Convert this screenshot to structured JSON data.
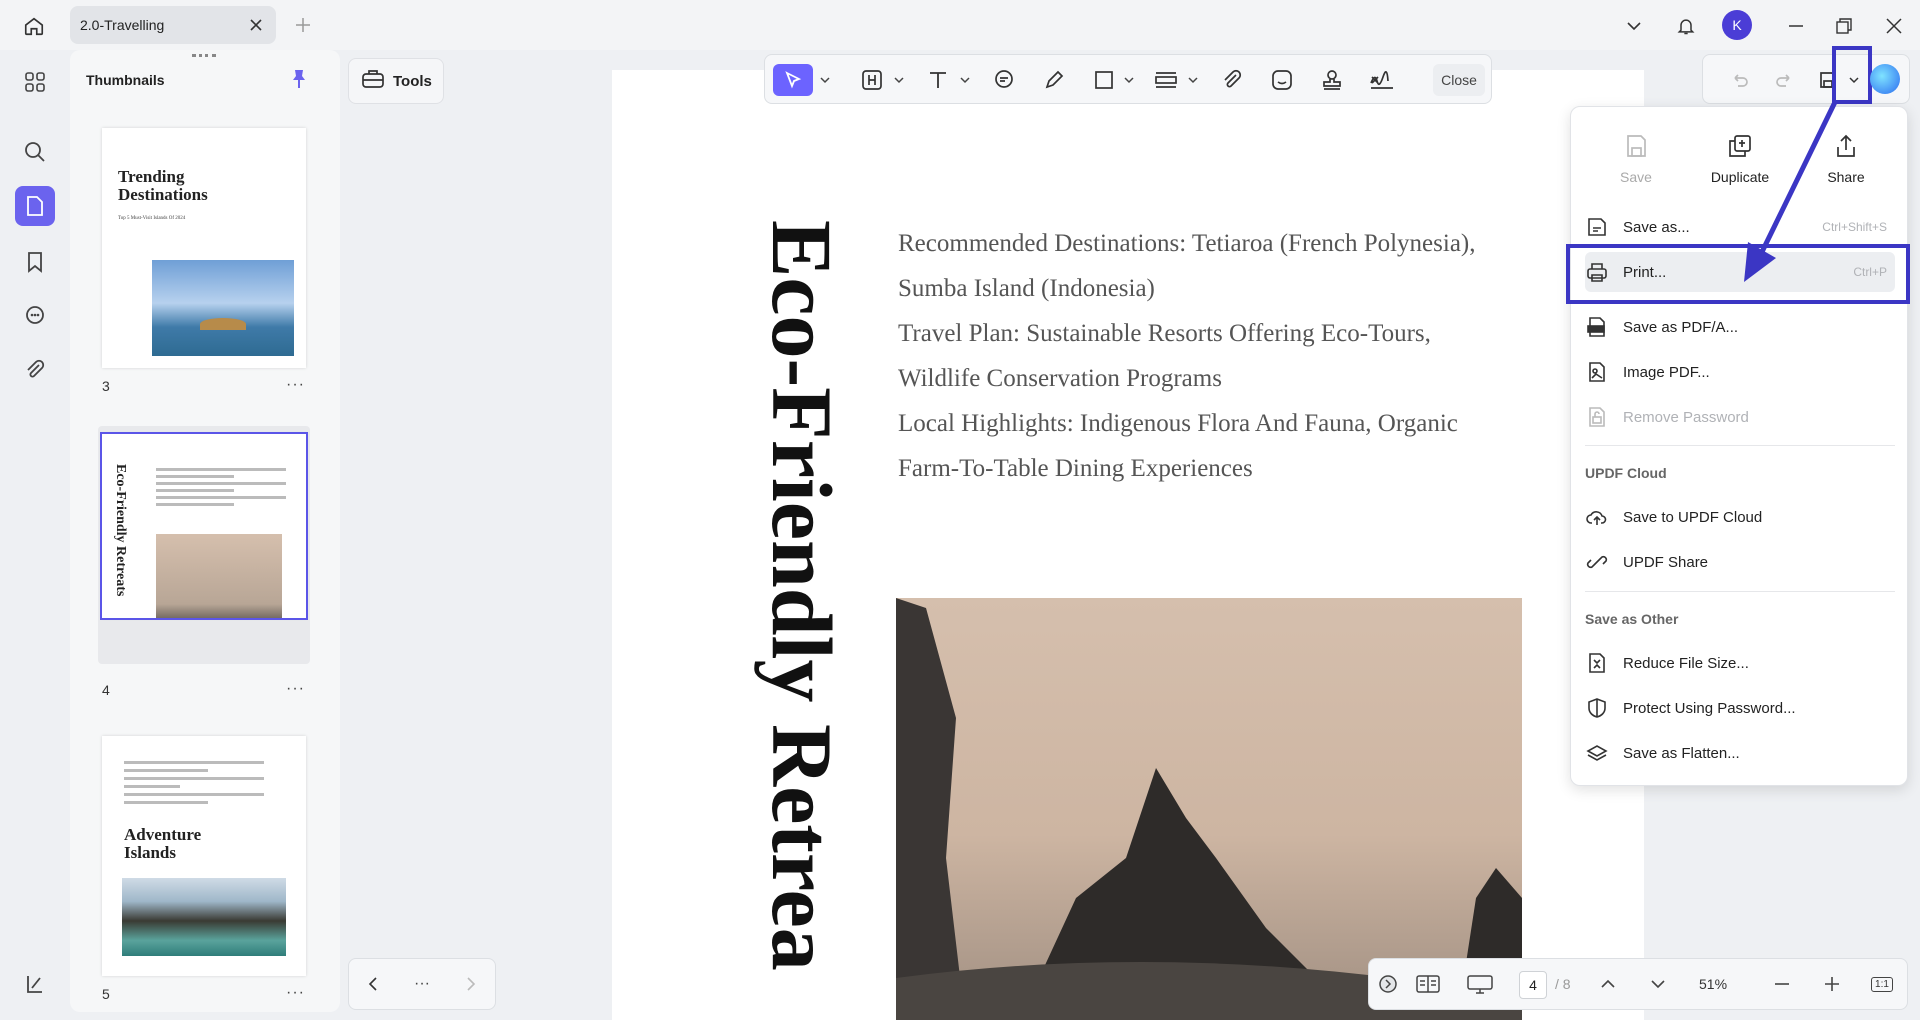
{
  "tab": {
    "title": "2.0-Travelling"
  },
  "avatar": {
    "letter": "K"
  },
  "thumbnails": {
    "title": "Thumbnails",
    "pages": [
      {
        "number": "3",
        "title_line1": "Trending",
        "title_line2": "Destinations",
        "subtitle": "Top 5 Must-Visit Islands Of 2024"
      },
      {
        "number": "4",
        "vertical_title": "Eco-Friendly Retreats"
      },
      {
        "number": "5",
        "title_line1": "Adventure",
        "title_line2": "Islands"
      }
    ],
    "more": "···"
  },
  "tools": {
    "label": "Tools"
  },
  "toolbar": {
    "close_label": "Close"
  },
  "document": {
    "vertical_title": "Eco-Friendly Retrea",
    "lines": [
      "Recommended Destinations: Tetiaroa (French Polynesia),",
      "Sumba Island (Indonesia)",
      "Travel Plan: Sustainable Resorts Offering Eco-Tours,",
      "Wildlife Conservation Programs",
      "Local Highlights: Indigenous Flora And Fauna, Organic",
      "Farm-To-Table Dining Experiences"
    ]
  },
  "menu": {
    "quick_actions": [
      {
        "label": "Save",
        "icon": "save-icon",
        "disabled": true
      },
      {
        "label": "Duplicate",
        "icon": "duplicate-icon",
        "disabled": false
      },
      {
        "label": "Share",
        "icon": "share-icon",
        "disabled": false
      }
    ],
    "items": [
      {
        "label": "Save as...",
        "shortcut": "Ctrl+Shift+S",
        "icon": "save-as-icon"
      },
      {
        "label": "Print...",
        "shortcut": "Ctrl+P",
        "icon": "print-icon"
      },
      {
        "label": "Save as PDF/A...",
        "shortcut": "",
        "icon": "pdfa-icon"
      },
      {
        "label": "Image PDF...",
        "shortcut": "",
        "icon": "image-pdf-icon"
      },
      {
        "label": "Remove Password",
        "shortcut": "",
        "icon": "remove-password-icon"
      }
    ],
    "cloud_section": "UPDF Cloud",
    "cloud_items": [
      {
        "label": "Save to UPDF Cloud",
        "icon": "cloud-upload-icon"
      },
      {
        "label": "UPDF Share",
        "icon": "link-icon"
      }
    ],
    "other_section": "Save as Other",
    "other_items": [
      {
        "label": "Reduce File Size...",
        "icon": "compress-icon"
      },
      {
        "label": "Protect Using Password...",
        "icon": "shield-icon"
      },
      {
        "label": "Save as Flatten...",
        "icon": "flatten-icon"
      }
    ]
  },
  "nav": {
    "more": "···"
  },
  "status": {
    "current_page": "4",
    "total_pages": "/ 8",
    "zoom": "51%",
    "fit_label": "1:1"
  },
  "colors": {
    "accent": "#6c63ff",
    "highlight": "#3b36c4"
  }
}
